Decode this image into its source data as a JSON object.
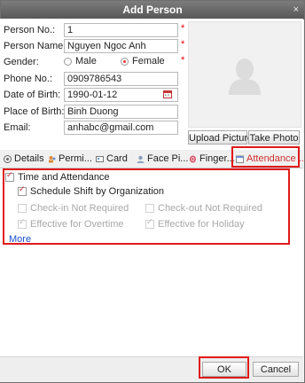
{
  "window": {
    "title": "Add Person",
    "close_glyph": "×"
  },
  "form": {
    "person_no": {
      "label": "Person No.:",
      "value": "1"
    },
    "person_name": {
      "label": "Person Name:",
      "value": "Nguyen Ngoc Anh"
    },
    "gender": {
      "label": "Gender:",
      "male": "Male",
      "female": "Female",
      "selected": "Female"
    },
    "phone": {
      "label": "Phone No.:",
      "value": "0909786543"
    },
    "dob": {
      "label": "Date of Birth:",
      "value": "1990-01-12"
    },
    "place_of_birth": {
      "label": "Place of Birth:",
      "value": "Binh Duong"
    },
    "email": {
      "label": "Email:",
      "value": "anhabc@gmail.com"
    },
    "required_mark": "*"
  },
  "photo": {
    "upload_label": "Upload Picture",
    "take_label": "Take Photo"
  },
  "tabs": [
    {
      "label": "Details",
      "icon": "details-icon"
    },
    {
      "label": "Permi...",
      "icon": "permission-icon"
    },
    {
      "label": "Card",
      "icon": "card-icon"
    },
    {
      "label": "Face Pi...",
      "icon": "face-icon"
    },
    {
      "label": "Finger...",
      "icon": "fingerprint-icon"
    },
    {
      "label": "Attendance ...",
      "icon": "attendance-icon",
      "active": true
    }
  ],
  "attendance": {
    "time_and_attendance": {
      "label": "Time and Attendance",
      "checked": true
    },
    "schedule_shift": {
      "label": "Schedule Shift by Organization",
      "checked": true
    },
    "checkin_not_required": {
      "label": "Check-in Not Required",
      "checked": false
    },
    "checkout_not_required": {
      "label": "Check-out Not Required",
      "checked": false
    },
    "effective_overtime": {
      "label": "Effective for Overtime",
      "checked": true
    },
    "effective_holiday": {
      "label": "Effective for Holiday",
      "checked": true
    },
    "more_link": "More"
  },
  "footer": {
    "ok_label": "OK",
    "cancel_label": "Cancel"
  },
  "colors": {
    "highlight": "#e01919",
    "titlebar": "#5e5e5e",
    "link": "#1f4fd0"
  }
}
